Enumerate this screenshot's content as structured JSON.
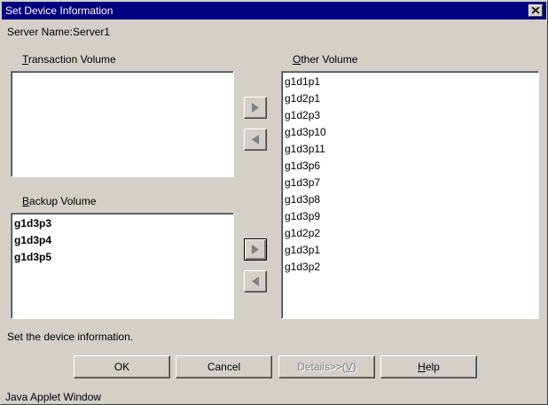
{
  "window": {
    "title": "Set Device Information",
    "server_label": "Server Name:Server1",
    "status_message": "Set the device information.",
    "footer": "Java Applet Window"
  },
  "transaction_volume": {
    "label_accel": "T",
    "label_rest": "ransaction Volume",
    "items": []
  },
  "backup_volume": {
    "label_accel": "B",
    "label_rest": "ackup Volume",
    "items": [
      "g1d3p3",
      "g1d3p4",
      "g1d3p5"
    ]
  },
  "other_volume": {
    "label_accel": "O",
    "label_rest": "ther Volume",
    "items": [
      "g1d1p1",
      "g1d2p1",
      "g1d2p3",
      "g1d3p10",
      "g1d3p11",
      "g1d3p6",
      "g1d3p7",
      "g1d3p8",
      "g1d3p9",
      "g1d2p2",
      "g1d3p1",
      "g1d3p2"
    ]
  },
  "buttons": {
    "ok": "OK",
    "cancel": "Cancel",
    "details_pre": "Details>>(",
    "details_accel": "V",
    "details_post": ")",
    "help_accel": "H",
    "help_rest": "elp"
  },
  "icons": {
    "close": "close-icon",
    "move_right": "triangle-right-icon",
    "move_left": "triangle-left-icon"
  },
  "colors": {
    "titlebar": "#000080",
    "face": "#d4d0c8",
    "disabled_text": "#808080"
  }
}
